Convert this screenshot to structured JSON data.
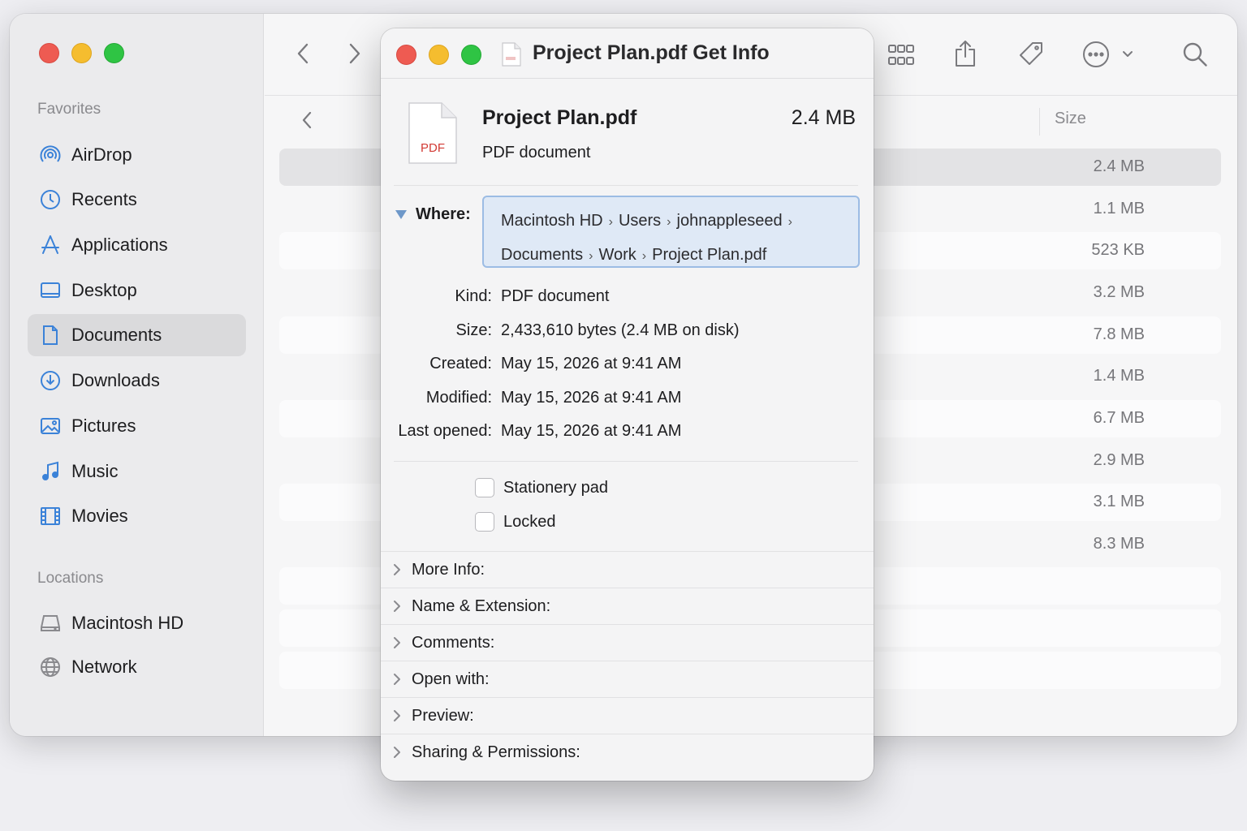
{
  "sidebar": {
    "favorites_header": "Favorites",
    "locations_header": "Locations",
    "favorites": [
      {
        "label": "AirDrop",
        "icon": "airdrop-icon"
      },
      {
        "label": "Recents",
        "icon": "clock-icon"
      },
      {
        "label": "Applications",
        "icon": "applications-icon"
      },
      {
        "label": "Desktop",
        "icon": "desktop-icon"
      },
      {
        "label": "Documents",
        "icon": "document-icon",
        "selected": true
      },
      {
        "label": "Downloads",
        "icon": "download-icon"
      },
      {
        "label": "Pictures",
        "icon": "pictures-icon"
      },
      {
        "label": "Music",
        "icon": "music-note-icon"
      },
      {
        "label": "Movies",
        "icon": "film-icon"
      }
    ],
    "locations": [
      {
        "label": "Macintosh HD",
        "icon": "hard-drive-icon"
      },
      {
        "label": "Network",
        "icon": "globe-icon"
      }
    ]
  },
  "toolbar": {
    "icons": [
      "back-icon",
      "forward-icon",
      "grid-view-icon",
      "share-icon",
      "tag-icon",
      "more-actions-icon",
      "search-icon"
    ]
  },
  "file_list": {
    "size_header": "Size",
    "sizes": [
      "2.4 MB",
      "1.1 MB",
      "523 KB",
      "3.2 MB",
      "7.8 MB",
      "1.4 MB",
      "6.7 MB",
      "2.9 MB",
      "3.1 MB",
      "8.3 MB"
    ]
  },
  "info": {
    "title": "Project Plan.pdf Get Info",
    "file_name": "Project Plan.pdf",
    "file_size": "2.4 MB",
    "file_kind": "PDF document",
    "icon_label": "PDF",
    "where_label": "Where:",
    "where_path_line1": [
      "Macintosh HD",
      "Users",
      "johnappleseed"
    ],
    "where_path_line2": [
      "Documents",
      "Work",
      "Project Plan.pdf"
    ],
    "meta": {
      "kind_label": "Kind:",
      "kind_value": "PDF document",
      "size_label": "Size:",
      "size_value": "2,433,610 bytes (2.4 MB on disk)",
      "created_label": "Created:",
      "created_value": "May 15, 2026 at 9:41 AM",
      "modified_label": "Modified:",
      "modified_value": "May 15, 2026 at 9:41 AM",
      "opened_label": "Last opened:",
      "opened_value": "May 15, 2026 at 9:41 AM"
    },
    "stationery_label": "Stationery pad",
    "locked_label": "Locked",
    "sections": [
      "More Info:",
      "Name & Extension:",
      "Comments:",
      "Open with:",
      "Preview:",
      "Sharing & Permissions:"
    ]
  },
  "colors": {
    "accent": "#3b82d8",
    "where_bg": "#dfe9f6",
    "close": "#ee5b52",
    "minimize": "#f5bd2f",
    "zoom": "#2fc444"
  }
}
